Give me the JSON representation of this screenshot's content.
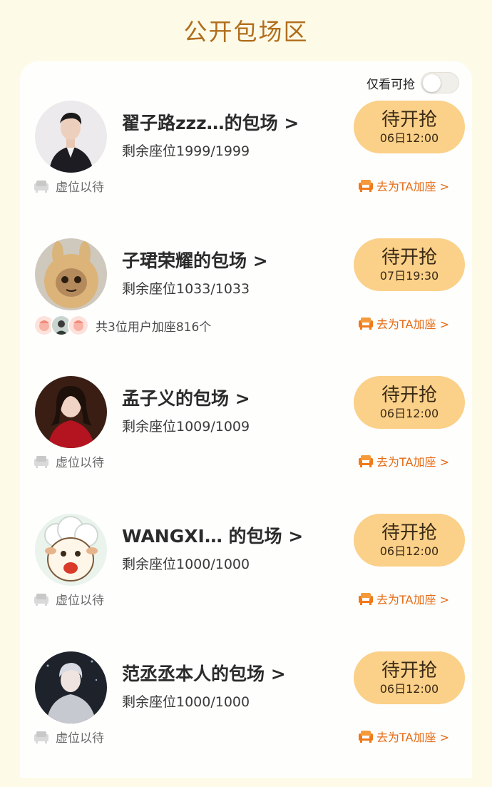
{
  "header": {
    "title": "公开包场区"
  },
  "filter": {
    "label": "仅看可抢",
    "enabled": false
  },
  "rooms": [
    {
      "title": "翟子路zzz…的包场 >",
      "seats": "剩余座位1999/1999",
      "button_label": "待开抢",
      "button_time": "06日12:00",
      "status_text": "虚位以待",
      "add_seat_label": "去为TA加座 >"
    },
    {
      "title": "子珺荣耀的包场 >",
      "seats": "剩余座位1033/1033",
      "button_label": "待开抢",
      "button_time": "07日19:30",
      "status_text": "共3位用户加座816个",
      "add_seat_label": "去为TA加座 >"
    },
    {
      "title": "孟子义的包场 >",
      "seats": "剩余座位1009/1009",
      "button_label": "待开抢",
      "button_time": "06日12:00",
      "status_text": "虚位以待",
      "add_seat_label": "去为TA加座 >"
    },
    {
      "title": "WANGXI…  的包场 >",
      "seats": "剩余座位1000/1000",
      "button_label": "待开抢",
      "button_time": "06日12:00",
      "status_text": "虚位以待",
      "add_seat_label": "去为TA加座 >"
    },
    {
      "title": "范丞丞本人的包场 >",
      "seats": "剩余座位1000/1000",
      "button_label": "待开抢",
      "button_time": "06日12:00",
      "status_text": "虚位以待",
      "add_seat_label": "去为TA加座 >"
    }
  ],
  "colors": {
    "background": "#fdfbe8",
    "title": "#b16e1d",
    "button": "#fbd088",
    "accent": "#e56a13"
  }
}
